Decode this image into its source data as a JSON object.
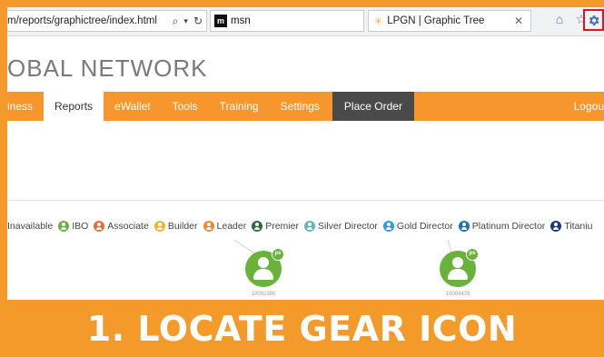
{
  "browser": {
    "address": "m/reports/graphictree/index.html",
    "search_icon": "search-icon",
    "refresh_icon": "refresh-icon",
    "tabs": [
      {
        "label": "msn"
      },
      {
        "label": "LPGN | Graphic Tree"
      }
    ],
    "icons": [
      "home-icon",
      "star-icon",
      "gear-icon"
    ]
  },
  "site": {
    "logo_text": "OBAL NETWORK"
  },
  "nav": {
    "items": [
      {
        "label": "iness"
      },
      {
        "label": "Reports"
      },
      {
        "label": "eWallet"
      },
      {
        "label": "Tools"
      },
      {
        "label": "Training"
      },
      {
        "label": "Settings"
      }
    ],
    "place_order": "Place Order",
    "logout": "Logou"
  },
  "legend": [
    {
      "label": "Inavailable",
      "color": ""
    },
    {
      "label": "IBO",
      "color": "#69b23b"
    },
    {
      "label": "Associate",
      "color": "#ef6a3b"
    },
    {
      "label": "Builder",
      "color": "#f2b431"
    },
    {
      "label": "Leader",
      "color": "#ef8a2b"
    },
    {
      "label": "Premier",
      "color": "#2f6b3e"
    },
    {
      "label": "Silver Director",
      "color": "#63b7b7"
    },
    {
      "label": "Gold Director",
      "color": "#2aa0d8"
    },
    {
      "label": "Platinum Director",
      "color": "#1e6fb8"
    },
    {
      "label": "Titaniu",
      "color": "#1b3a7a"
    }
  ],
  "tree": {
    "nodes": [
      {
        "id": "10002380",
        "badge": "ps"
      },
      {
        "id": "10003478",
        "badge": "ps"
      }
    ]
  },
  "banner": {
    "text": "1. LOCATE GEAR ICON"
  },
  "colors": {
    "accent": "#f39a2b",
    "nav": "#f7962c",
    "highlight": "#e3121b"
  }
}
